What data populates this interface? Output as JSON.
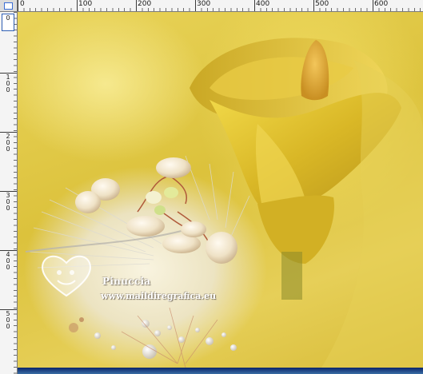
{
  "rulers": {
    "horizontal_labels": [
      "0",
      "100",
      "200",
      "300",
      "400",
      "500",
      "600"
    ],
    "vertical_labels": [
      "0",
      "1\n0\n0",
      "2\n0\n0",
      "3\n0\n0",
      "4\n0\n0",
      "5\n0\n0"
    ]
  },
  "canvas": {
    "description_colors": {
      "background": "#dfc84a",
      "calla": "#d9b826",
      "blossom": "#f3efe2"
    }
  },
  "watermark": {
    "name": "Pinuccia",
    "url": "www.maildiregrafica.eu"
  },
  "accent": "#0a246a"
}
